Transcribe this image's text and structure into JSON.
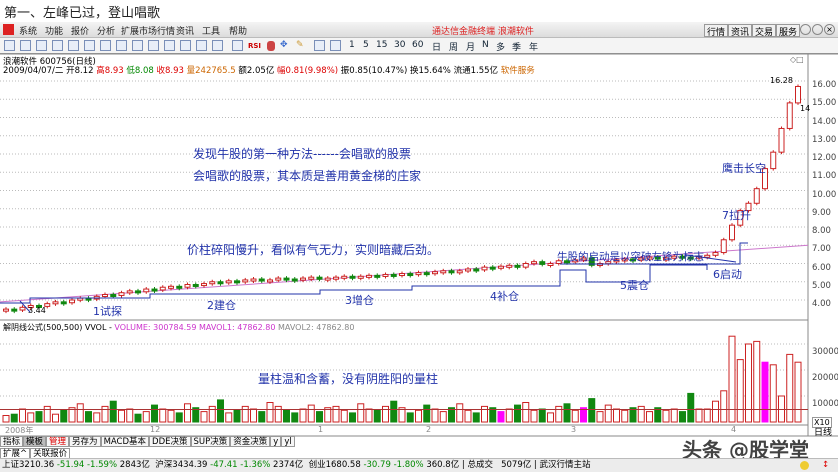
{
  "title": "第一、左峰已过，登山唱歌",
  "menu": [
    "系统",
    "功能",
    "报价",
    "分析",
    "扩展市场行情",
    "资讯",
    "工具",
    "帮助"
  ],
  "menu_center": "通达信金融终端  浪潮软件",
  "right_buttons": [
    "行情",
    "资讯",
    "交易",
    "服务"
  ],
  "timeframes": [
    "1",
    "5",
    "15",
    "30",
    "60",
    "日",
    "周",
    "月",
    "N",
    "多",
    "季",
    "年"
  ],
  "toolbar_text": {
    "rsi": "RSI"
  },
  "info": {
    "name": "浪潮软件 600756(日线)",
    "date": "2009/04/07/二",
    "open": "开8.12",
    "high": "高8.93",
    "low": "低8.08",
    "close": "收8.93",
    "vol": "量242765.5",
    "amount": "额2.05亿",
    "change": "幅0.81(9.98%)",
    "amp": "振0.85(10.47%)",
    "turnover": "换15.64%",
    "float": "流通1.55亿",
    "service": "软件服务"
  },
  "price_axis": [
    "16.00",
    "15.00",
    "14.00",
    "13.00",
    "12.00",
    "11.00",
    "10.00",
    "9.00",
    "8.00",
    "7.00",
    "6.00",
    "5.00",
    "4.00"
  ],
  "vol_axis": [
    "30000",
    "20000",
    "10000"
  ],
  "vol_unit": "X10",
  "high_label": "16.28",
  "low_label": "3.44",
  "last_label": "14",
  "vol_header": {
    "formula": "解阴线公式(500,500) VVOL -",
    "volume": "VOLUME: 300784.59",
    "mavol1": "MAVOL1: 47862.80",
    "mavol2": "MAVOL2: 47862.80"
  },
  "date_axis": [
    "2008年",
    "12",
    "1",
    "2",
    "3",
    "4"
  ],
  "period": "日线",
  "annotations": {
    "headline1": "发现牛股的第一种方法------会唱歌的股票",
    "headline2": "会唱歌的股票，其本质是善用黄金梯的庄家",
    "price_note": "价柱碎阳慢升，看似有气无力，实则暗藏后劲。",
    "breakout": "牛股的启动是以突破左锋为标志",
    "s1": "1试探",
    "s2": "2建仓",
    "s3": "3增仓",
    "s4": "4补仓",
    "s5": "5震仓",
    "s6": "6启动",
    "s7": "7拉升",
    "s8": "鹰击长空",
    "vol_note": "量柱温和含蓄，没有阴胜阳的量柱"
  },
  "tabs": [
    "指标",
    "模板",
    "管理",
    "另存为",
    "MACD基本",
    "DDE决策",
    "SUP决策",
    "资金决策",
    "y",
    "yl"
  ],
  "tabs2": [
    "扩展^",
    "关联报价"
  ],
  "status": {
    "sh": "上证3210.36",
    "sh_chg": "-51.94",
    "sh_pct": "-1.59%",
    "sh_amt": "2843亿",
    "sz": "沪深3434.39",
    "sz_chg": "-47.41",
    "sz_pct": "-1.36%",
    "sz_amt": "2374亿",
    "cy": "创业1680.58",
    "cy_chg": "-30.79",
    "cy_pct": "-1.80%",
    "cy_amt": "360.8亿",
    "total": "总成交",
    "total_amt": "5079亿",
    "station": "武汉行情主站"
  },
  "watermark": "头条 @股学堂",
  "colors": {
    "up": "#cc2222",
    "down": "#118811",
    "ma": "#cc77cc",
    "annotation": "#2233aa",
    "highlight": "#ff00ff"
  },
  "chart_data": {
    "type": "candlestick",
    "ylim": [
      3.0,
      16.5
    ],
    "closes": [
      3.5,
      3.45,
      3.6,
      3.7,
      3.65,
      3.8,
      3.9,
      3.85,
      4.0,
      4.1,
      4.05,
      4.2,
      4.3,
      4.25,
      4.4,
      4.5,
      4.45,
      4.6,
      4.55,
      4.7,
      4.75,
      4.7,
      4.85,
      4.8,
      4.9,
      5.0,
      4.95,
      5.05,
      5.0,
      5.1,
      5.15,
      5.05,
      5.1,
      5.2,
      5.15,
      5.1,
      5.2,
      5.25,
      5.15,
      5.2,
      5.25,
      5.3,
      5.2,
      5.3,
      5.35,
      5.3,
      5.4,
      5.35,
      5.45,
      5.4,
      5.5,
      5.45,
      5.55,
      5.6,
      5.5,
      5.6,
      5.7,
      5.65,
      5.8,
      5.75,
      5.85,
      5.9,
      5.8,
      6.0,
      6.1,
      5.95,
      6.0,
      6.15,
      6.1,
      6.2,
      6.3,
      5.9,
      6.0,
      6.1,
      6.2,
      6.25,
      6.2,
      6.3,
      6.35,
      6.25,
      6.3,
      6.4,
      6.35,
      6.3,
      6.4,
      6.45,
      6.6,
      7.3,
      8.1,
      8.9,
      9.3,
      10.1,
      11.2,
      12.1,
      13.4,
      14.8,
      15.7
    ],
    "volumes": [
      2500,
      3000,
      5000,
      3500,
      4000,
      6000,
      3000,
      4500,
      5500,
      7000,
      4000,
      3500,
      6000,
      8000,
      4500,
      5000,
      3000,
      4000,
      6500,
      5000,
      4500,
      3500,
      7000,
      5500,
      4000,
      6000,
      8500,
      3500,
      4500,
      6000,
      5000,
      4000,
      7500,
      6000,
      4500,
      3500,
      5000,
      6500,
      4000,
      5500,
      6000,
      4500,
      3500,
      7000,
      5000,
      4500,
      6000,
      8000,
      5500,
      3500,
      4500,
      6500,
      5000,
      4000,
      5500,
      7000,
      4500,
      3500,
      6000,
      5500,
      4000,
      5000,
      6500,
      7500,
      4500,
      5000,
      3500,
      6000,
      7000,
      4500,
      5500,
      9000,
      4000,
      6500,
      5000,
      4500,
      5500,
      6000,
      4000,
      5500,
      4500,
      5000,
      4000,
      11000,
      5000,
      5000,
      8000,
      12000,
      33000,
      24000,
      30000,
      31000,
      23000,
      22000,
      10000,
      26000,
      23000
    ],
    "highlight_volume_indices": [
      92,
      60,
      70
    ],
    "ma_range": [
      3.9,
      7.0
    ]
  }
}
